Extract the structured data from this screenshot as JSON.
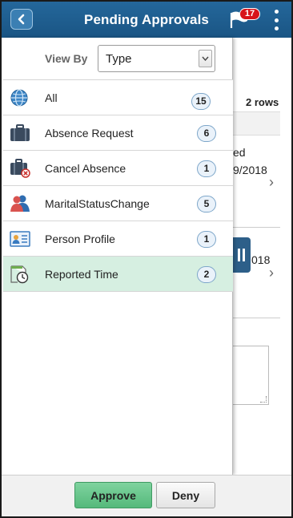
{
  "header": {
    "title": "Pending Approvals",
    "notification_count": "17"
  },
  "background": {
    "rows_count": "2 rows",
    "row1_line1": "ed",
    "row1_line2": "9/2018",
    "row2_line1": "018",
    "chevron": "›"
  },
  "viewby": {
    "label": "View By",
    "selected": "Type"
  },
  "items": [
    {
      "label": "All",
      "count": "15",
      "icon": "globe-icon"
    },
    {
      "label": "Absence Request",
      "count": "6",
      "icon": "briefcase-icon"
    },
    {
      "label": "Cancel Absence",
      "count": "1",
      "icon": "briefcase-cancel-icon"
    },
    {
      "label": "MaritalStatusChange",
      "count": "5",
      "icon": "people-icon"
    },
    {
      "label": "Person Profile",
      "count": "1",
      "icon": "id-card-icon"
    },
    {
      "label": "Reported Time",
      "count": "2",
      "icon": "timesheet-clock-icon",
      "selected": true
    }
  ],
  "footer": {
    "approve_label": "Approve",
    "deny_label": "Deny"
  },
  "colors": {
    "header": "#1e5a8a",
    "selected_row": "#d6efe1",
    "approve": "#5cbf80",
    "badge": "#d8141a"
  }
}
